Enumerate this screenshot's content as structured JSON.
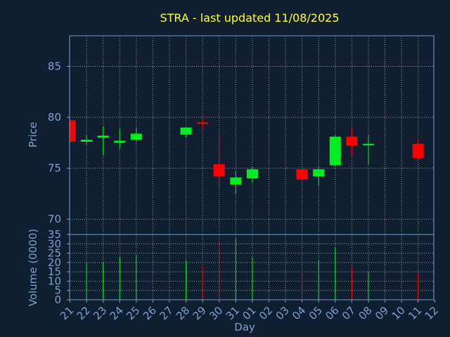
{
  "chart_data": {
    "type": "candlestick",
    "title": "STRA - last updated 11/08/2025",
    "xlabel": "Day",
    "price_ylabel": "Price",
    "volume_ylabel": "Volume (0000)",
    "price_ylim": [
      68.5,
      88
    ],
    "price_yticks": [
      70,
      75,
      80,
      85
    ],
    "volume_ylim": [
      0,
      35
    ],
    "volume_yticks": [
      0,
      5,
      10,
      15,
      20,
      25,
      30,
      35
    ],
    "x_tick_labels": [
      "21",
      "22",
      "23",
      "24",
      "25",
      "26",
      "27",
      "28",
      "29",
      "30",
      "31",
      "01",
      "02",
      "03",
      "04",
      "05",
      "06",
      "07",
      "08",
      "09",
      "10",
      "11",
      "12"
    ],
    "grid": true,
    "colors": {
      "up": "#00ee22",
      "down": "#ff0000",
      "background": "#0f1f2f",
      "title": "#ffff33",
      "axis_text": "#7f9fcf",
      "grid": "#c8c8c8"
    },
    "candles": [
      {
        "day": "21",
        "open": 79.7,
        "high": 79.9,
        "low": 77.5,
        "close": 77.6
      },
      {
        "day": "22",
        "open": 77.6,
        "high": 78.3,
        "low": 77.3,
        "close": 77.8,
        "volume": 20
      },
      {
        "day": "23",
        "open": 78.0,
        "high": 79.1,
        "low": 76.3,
        "close": 78.2,
        "volume": 20
      },
      {
        "day": "24",
        "open": 77.5,
        "high": 78.9,
        "low": 76.9,
        "close": 77.7,
        "volume": 23
      },
      {
        "day": "25",
        "open": 77.8,
        "high": 79.0,
        "low": 77.6,
        "close": 78.4,
        "volume": 24
      },
      {
        "day": "28",
        "open": 78.3,
        "high": 79.0,
        "low": 78.0,
        "close": 79.0,
        "volume": 21
      },
      {
        "day": "29",
        "open": 79.5,
        "high": 80.0,
        "low": 78.8,
        "close": 79.4,
        "volume": 18
      },
      {
        "day": "30",
        "open": 75.4,
        "high": 78.5,
        "low": 73.1,
        "close": 74.2,
        "volume": 31
      },
      {
        "day": "31",
        "open": 73.4,
        "high": 74.7,
        "low": 72.5,
        "close": 74.1,
        "volume": 33
      },
      {
        "day": "01",
        "open": 74.0,
        "high": 75.1,
        "low": 73.6,
        "close": 74.9,
        "volume": 23
      },
      {
        "day": "04",
        "open": 74.9,
        "high": 75.0,
        "low": 72.9,
        "close": 73.9,
        "volume": 16
      },
      {
        "day": "05",
        "open": 74.2,
        "high": 75.1,
        "low": 73.3,
        "close": 74.9,
        "volume": 21
      },
      {
        "day": "06",
        "open": 75.3,
        "high": 78.2,
        "low": 75.2,
        "close": 78.1,
        "volume": 28
      },
      {
        "day": "07",
        "open": 78.1,
        "high": 79.0,
        "low": 76.3,
        "close": 77.2,
        "volume": 17
      },
      {
        "day": "08",
        "open": 77.3,
        "high": 78.2,
        "low": 75.4,
        "close": 77.4,
        "volume": 15
      },
      {
        "day": "11",
        "open": 77.4,
        "high": 77.9,
        "low": 75.8,
        "close": 76.0,
        "volume": 14
      }
    ]
  }
}
